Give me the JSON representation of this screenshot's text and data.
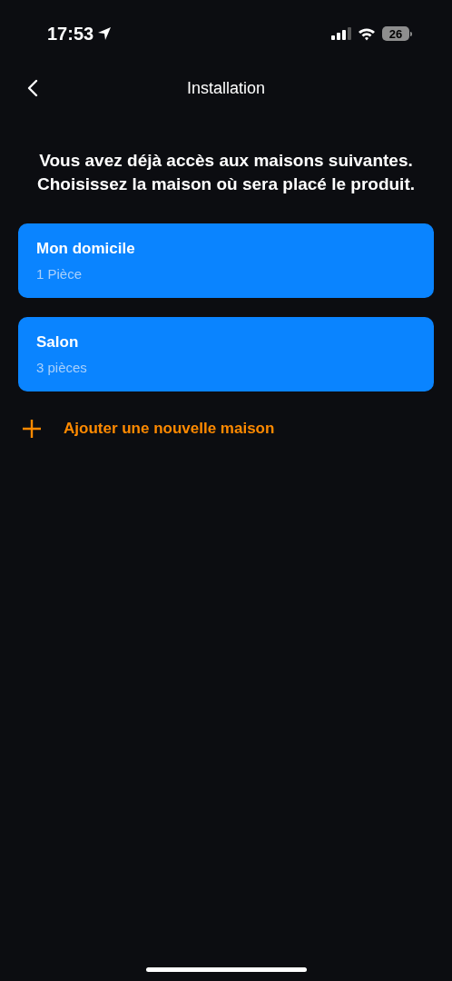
{
  "status_bar": {
    "time": "17:53",
    "battery": "26"
  },
  "nav": {
    "title": "Installation"
  },
  "intro": "Vous avez déjà accès aux maisons suivantes. Choisissez la maison où sera placé le produit.",
  "homes": [
    {
      "name": "Mon domicile",
      "rooms": "1 Pièce"
    },
    {
      "name": "Salon",
      "rooms": "3 pièces"
    }
  ],
  "add_home": {
    "label": "Ajouter une nouvelle maison"
  }
}
